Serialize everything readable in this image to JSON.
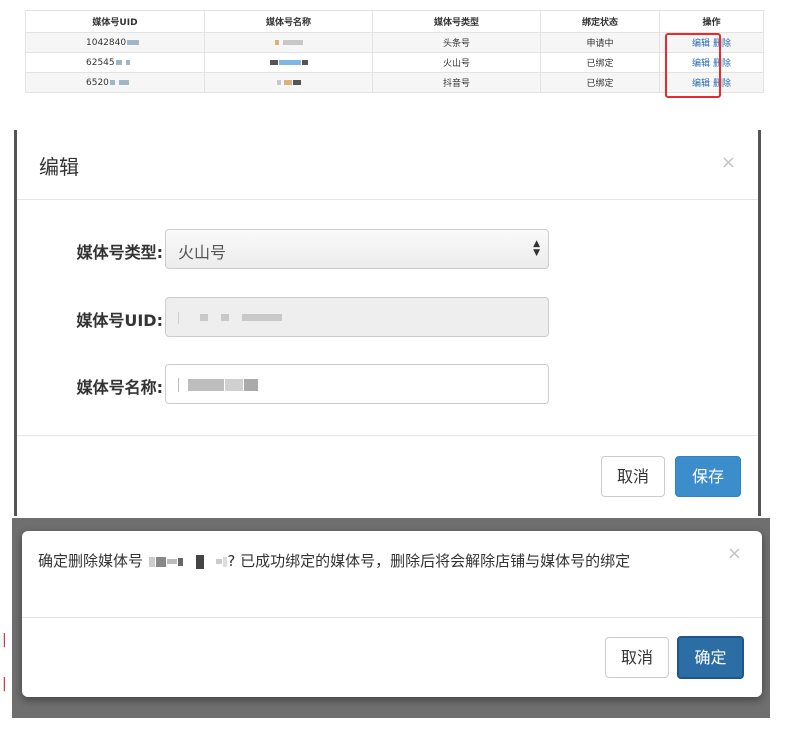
{
  "table": {
    "headers": [
      "媒体号UID",
      "媒体号名称",
      "媒体号类型",
      "绑定状态",
      "操作"
    ],
    "rows": [
      {
        "uid": "1042840",
        "type": "头条号",
        "status": "申请中",
        "edit": "编辑",
        "delete": "删除"
      },
      {
        "uid": "62545",
        "type": "火山号",
        "status": "已绑定",
        "edit": "编辑",
        "delete": "删除"
      },
      {
        "uid": "6520",
        "type": "抖音号",
        "status": "已绑定",
        "edit": "编辑",
        "delete": "删除"
      }
    ]
  },
  "edit_modal": {
    "title": "编辑",
    "close": "×",
    "type_label": "媒体号类型:",
    "type_value": "火山号",
    "uid_label": "媒体号UID:",
    "name_label": "媒体号名称:",
    "cancel_label": "取消",
    "save_label": "保存"
  },
  "confirm_dialog": {
    "message_prefix": "确定删除媒体号",
    "message_suffix": "? 已成功绑定的媒体号，删除后将会解除店铺与媒体号的绑定",
    "close": "×",
    "cancel_label": "取消",
    "ok_label": "确定"
  },
  "colors": {
    "link": "#2a6db5",
    "highlight_box": "#e52b2b",
    "primary_button": "#3c8dcc",
    "confirm_button": "#2d6da6"
  }
}
